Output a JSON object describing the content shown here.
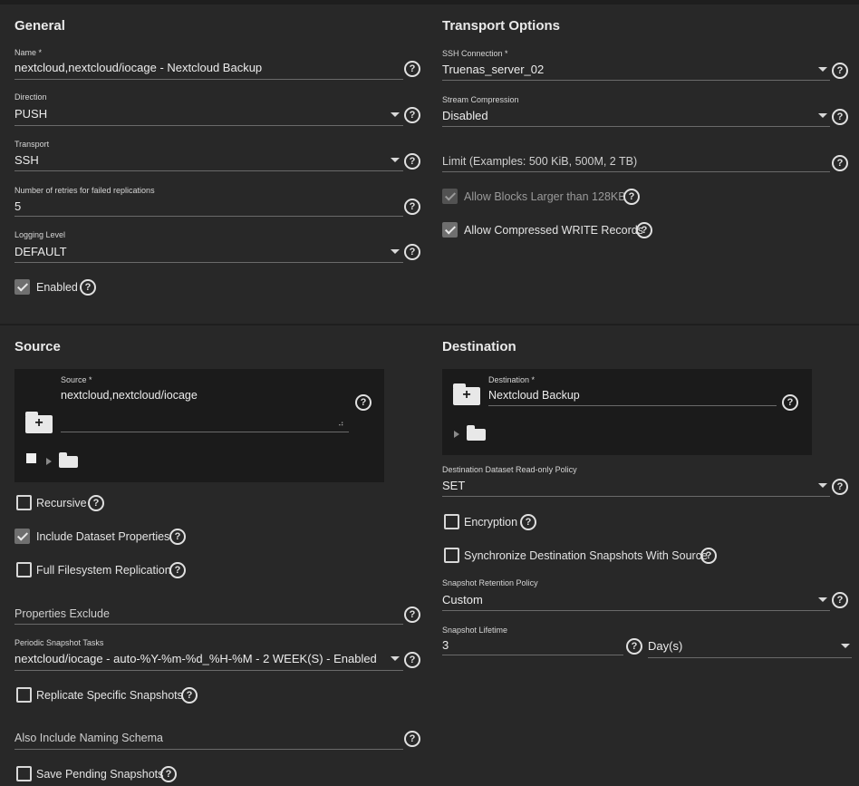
{
  "general": {
    "title": "General",
    "name": {
      "label": "Name *",
      "value": "nextcloud,nextcloud/iocage - Nextcloud Backup"
    },
    "direction": {
      "label": "Direction",
      "value": "PUSH"
    },
    "transport": {
      "label": "Transport",
      "value": "SSH"
    },
    "retries": {
      "label": "Number of retries for failed replications",
      "value": "5"
    },
    "logging": {
      "label": "Logging Level",
      "value": "DEFAULT"
    },
    "enabled": {
      "label": "Enabled",
      "checked": true
    }
  },
  "transport_options": {
    "title": "Transport Options",
    "ssh_connection": {
      "label": "SSH Connection *",
      "value": "Truenas_server_02"
    },
    "stream_compression": {
      "label": "Stream Compression",
      "value": "Disabled"
    },
    "limit": {
      "placeholder": "Limit (Examples: 500 KiB, 500M, 2 TB)"
    },
    "allow_large_blocks": {
      "label": "Allow Blocks Larger than 128KB",
      "checked": true,
      "disabled": true
    },
    "allow_compressed": {
      "label": "Allow Compressed WRITE Records",
      "checked": true
    }
  },
  "source": {
    "title": "Source",
    "source_field": {
      "label": "Source *",
      "value": "nextcloud,nextcloud/iocage"
    },
    "recursive": {
      "label": "Recursive",
      "checked": false
    },
    "include_props": {
      "label": "Include Dataset Properties",
      "checked": true
    },
    "full_fs": {
      "label": "Full Filesystem Replication",
      "checked": false
    },
    "properties_exclude": {
      "placeholder": "Properties Exclude"
    },
    "periodic_tasks": {
      "label": "Periodic Snapshot Tasks",
      "value": "nextcloud/iocage - auto-%Y-%m-%d_%H-%M - 2 WEEK(S) - Enabled"
    },
    "replicate_specific": {
      "label": "Replicate Specific Snapshots",
      "checked": false
    },
    "naming_schema": {
      "placeholder": "Also Include Naming Schema"
    },
    "save_pending": {
      "label": "Save Pending Snapshots",
      "checked": false
    }
  },
  "destination": {
    "title": "Destination",
    "dest_field": {
      "label": "Destination *",
      "value": "Nextcloud Backup"
    },
    "readonly_policy": {
      "label": "Destination Dataset Read-only Policy",
      "value": "SET"
    },
    "encryption": {
      "label": "Encryption",
      "checked": false
    },
    "sync_snapshots": {
      "label": "Synchronize Destination Snapshots With Source",
      "checked": false
    },
    "retention_policy": {
      "label": "Snapshot Retention Policy",
      "value": "Custom"
    },
    "lifetime": {
      "label": "Snapshot Lifetime",
      "value": "3",
      "unit": "Day(s)"
    }
  },
  "icons": {
    "help": "?",
    "plus": "+"
  }
}
